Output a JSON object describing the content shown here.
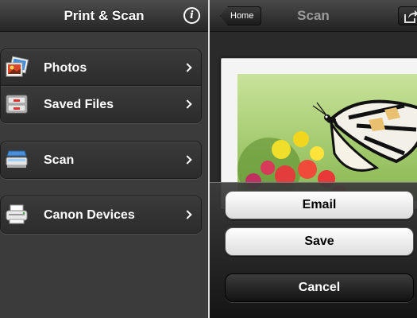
{
  "left_screen": {
    "title": "Print & Scan",
    "info_button_glyph": "i",
    "menu_groups": [
      {
        "items": [
          {
            "label": "Photos",
            "icon": "photos-icon"
          },
          {
            "label": "Saved Files",
            "icon": "saved-files-icon"
          }
        ]
      },
      {
        "items": [
          {
            "label": "Scan",
            "icon": "scanner-icon"
          }
        ]
      },
      {
        "items": [
          {
            "label": "Canon Devices",
            "icon": "printer-icon"
          }
        ]
      }
    ]
  },
  "right_screen": {
    "title": "Scan",
    "back_button": "Home",
    "share_icon": "share-icon",
    "preview_image": "butterfly-on-flowers-photo",
    "action_sheet": {
      "buttons": [
        "Email",
        "Save"
      ],
      "cancel": "Cancel"
    }
  },
  "colors": {
    "background": "#3b3b3b",
    "light_button": "#f2f2f2",
    "dark_button": "#1f1f1f"
  }
}
